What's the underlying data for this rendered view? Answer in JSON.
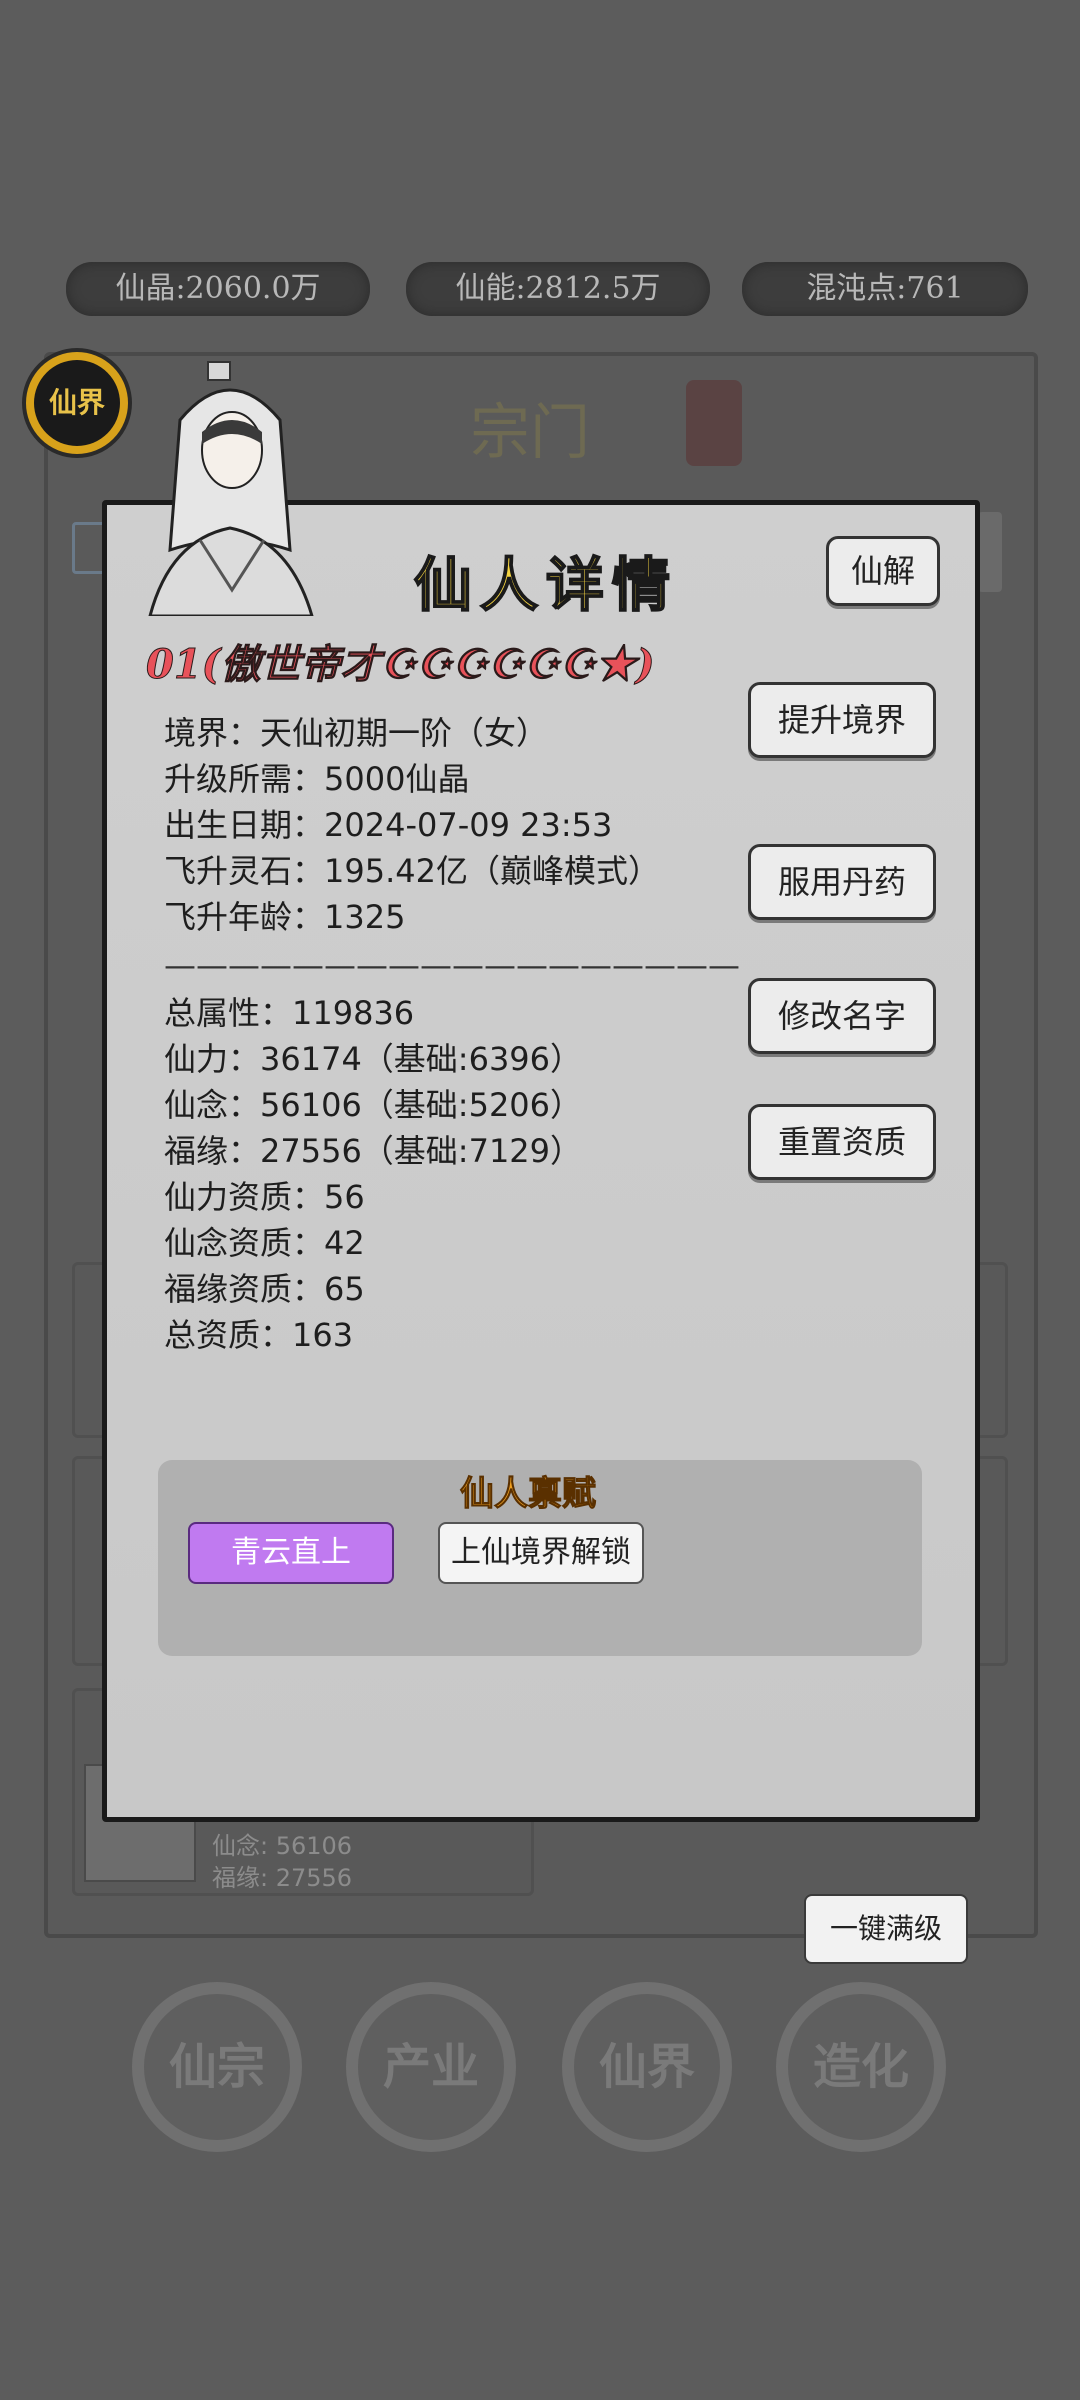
{
  "resources": [
    {
      "label": "仙晶:2060.0万"
    },
    {
      "label": "仙能:2812.5万"
    },
    {
      "label": "混沌点:761"
    }
  ],
  "badge": {
    "label": "仙界"
  },
  "background": {
    "title": "宗门",
    "card_stats": [
      "仙念: 56106",
      "福缘: 27556"
    ],
    "onekey_button": "一键满级"
  },
  "modal": {
    "title": "仙人详情",
    "dissolve_button": "仙解",
    "name_line": "01(傲世帝才☪☪☪☪☪☪★)",
    "info_rows": [
      "境界：天仙初期一阶（女）",
      "升级所需：5000仙晶",
      "出生日期：2024-07-09 23:53",
      "飞升灵石：195.42亿（巅峰模式）",
      "飞升年龄：1325"
    ],
    "divider": "——————————————————",
    "stat_rows": [
      "总属性：119836",
      "仙力：36174（基础:6396）",
      "仙念：56106（基础:5206）",
      "福缘：27556（基础:7129）",
      "仙力资质：56",
      "仙念资质：42",
      "福缘资质：65",
      "总资质：163"
    ],
    "actions": {
      "upgrade": "提升境界",
      "pill": "服用丹药",
      "rename": "修改名字",
      "reset": "重置资质"
    },
    "talent": {
      "title": "仙人禀赋",
      "items": [
        "青云直上",
        "上仙境界解锁"
      ]
    }
  },
  "nav": [
    "仙宗",
    "产业",
    "仙界",
    "造化"
  ],
  "colors": {
    "accent_title": "#f5d441",
    "name_red": "#e8525a",
    "talent_purple": "#c07af0",
    "talent_orange": "#f0a020"
  }
}
